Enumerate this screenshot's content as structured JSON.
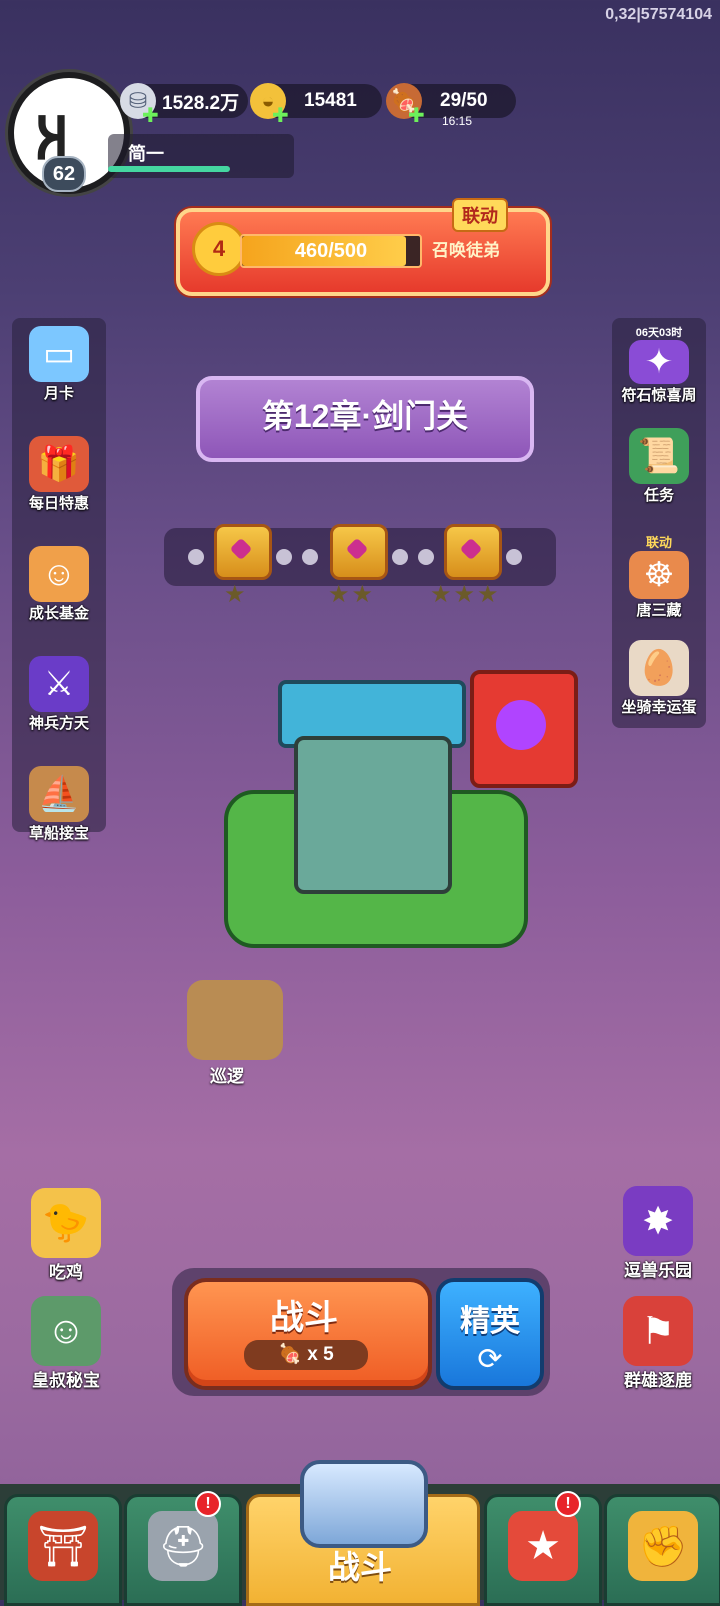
{
  "debug": "0,32|57574104",
  "player": {
    "level": "62",
    "name": "简一",
    "xp_fraction": 0.68
  },
  "resources": {
    "silver": {
      "value": "1528.2万",
      "icon": "silver-coin-icon"
    },
    "gold": {
      "value": "15481",
      "icon": "gold-ingot-icon"
    },
    "food": {
      "value": "29/50",
      "timer": "16:15",
      "icon": "meat-icon"
    }
  },
  "link_event": {
    "tag": "联动",
    "level": "4",
    "progress": "460/500",
    "progress_fraction": 0.92,
    "cta": "召唤徒弟"
  },
  "left_menu": [
    {
      "label": "月卡",
      "icon": "monthly-card-icon"
    },
    {
      "label": "每日特惠",
      "icon": "daily-gift-icon"
    },
    {
      "label": "成长基金",
      "icon": "growth-fund-icon"
    },
    {
      "label": "神兵方天",
      "icon": "divine-weapon-icon"
    },
    {
      "label": "草船接宝",
      "icon": "boat-treasure-icon"
    }
  ],
  "right_menu": [
    {
      "label": "符石惊喜周",
      "timer": "06天03时",
      "icon": "rune-surprise-icon"
    },
    {
      "label": "任务",
      "icon": "quest-scroll-icon"
    },
    {
      "label": "唐三藏",
      "tag": "联动",
      "icon": "tang-sanzang-icon"
    },
    {
      "label": "坐骑幸运蛋",
      "icon": "mount-egg-icon"
    }
  ],
  "chapter": {
    "title": "第12章·剑门关"
  },
  "chest_rewards": [
    {
      "stars": "★"
    },
    {
      "stars": "★★"
    },
    {
      "stars": "★★★"
    }
  ],
  "patrol": {
    "label": "巡逻"
  },
  "bottom_left_buttons": [
    {
      "label": "吃鸡",
      "icon": "chicken-event-icon"
    },
    {
      "label": "皇叔秘宝",
      "icon": "royal-treasure-icon"
    }
  ],
  "bottom_right_buttons": [
    {
      "label": "逗兽乐园",
      "icon": "beast-park-icon"
    },
    {
      "label": "群雄逐鹿",
      "icon": "warlords-icon"
    }
  ],
  "battle": {
    "label": "战斗",
    "cost": "x 5",
    "elite_label": "精英"
  },
  "nav": {
    "center_label": "战斗",
    "tabs": [
      {
        "icon": "city-gate-icon"
      },
      {
        "icon": "helmet-icon",
        "badge": "!"
      },
      {
        "icon": "battle-emblem-icon"
      },
      {
        "icon": "horn-stars-icon",
        "badge": "!"
      },
      {
        "icon": "fist-upgrade-icon"
      }
    ]
  }
}
